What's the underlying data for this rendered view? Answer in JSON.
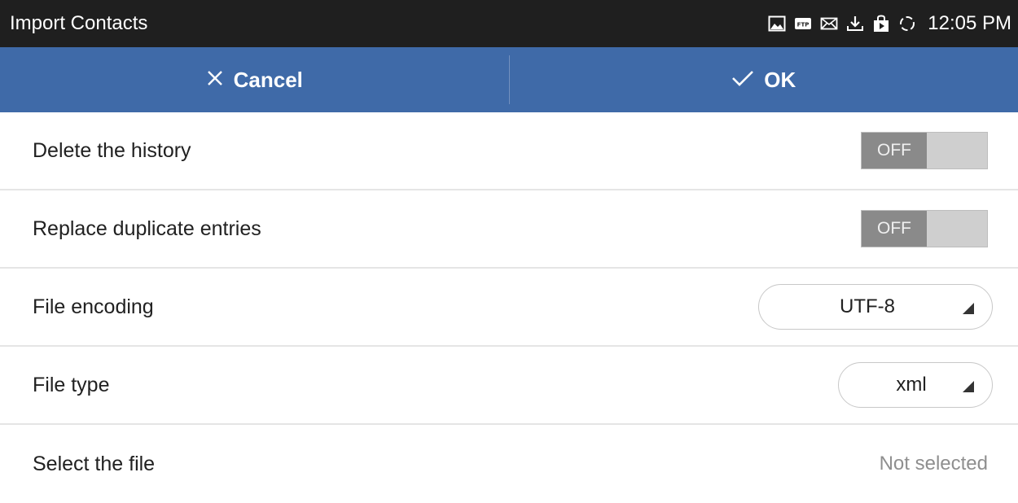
{
  "status_bar": {
    "title": "Import Contacts",
    "icons": [
      "image-icon",
      "ftp-icon",
      "mail-icon",
      "download-icon",
      "store-bag-icon",
      "sync-icon"
    ],
    "ftp_label": "FTP",
    "time": "12:05 PM"
  },
  "action_bar": {
    "cancel_label": "Cancel",
    "ok_label": "OK",
    "background_color": "#3f6aa8"
  },
  "settings": {
    "delete_history": {
      "label": "Delete the history",
      "toggle": "OFF"
    },
    "replace_duplicates": {
      "label": "Replace duplicate entries",
      "toggle": "OFF"
    },
    "file_encoding": {
      "label": "File encoding",
      "value": "UTF-8"
    },
    "file_type": {
      "label": "File type",
      "value": "xml"
    },
    "select_file": {
      "label": "Select the file",
      "value": "Not selected"
    }
  }
}
